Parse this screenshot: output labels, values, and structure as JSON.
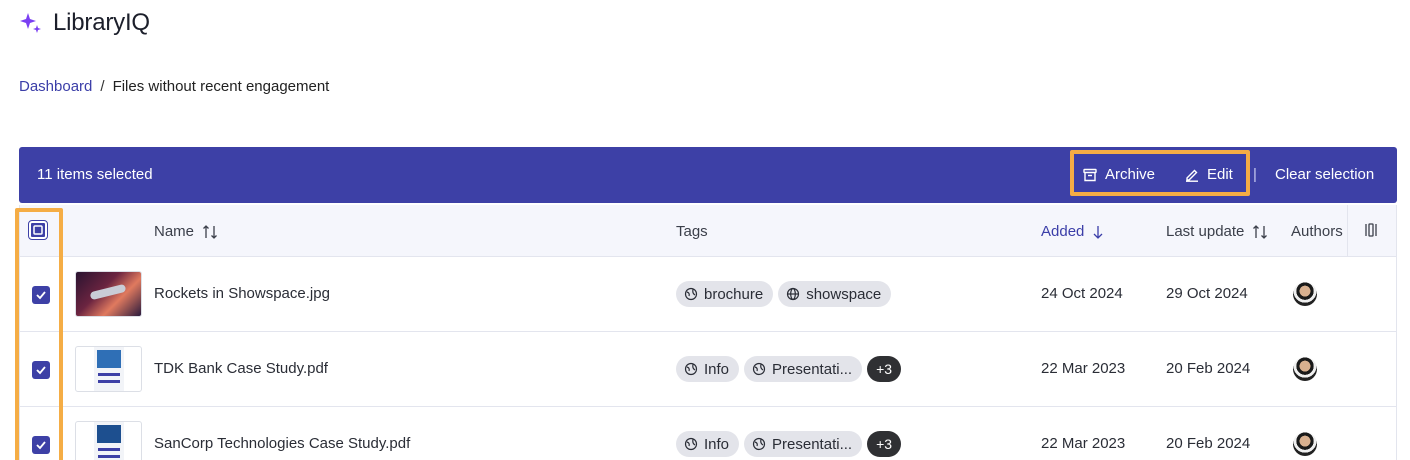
{
  "app": {
    "title": "LibraryIQ",
    "accent": "#3d40a6",
    "highlight": "#f5ad45"
  },
  "breadcrumb": {
    "parent": "Dashboard",
    "separator": "/",
    "current": "Files without recent engagement"
  },
  "selection_bar": {
    "count_text": "11 items selected",
    "archive_label": "Archive",
    "edit_label": "Edit",
    "divider": "|",
    "clear_label": "Clear selection"
  },
  "table": {
    "columns": {
      "name": "Name",
      "tags": "Tags",
      "added": "Added",
      "last_update": "Last update",
      "authors": "Authors"
    },
    "rows": [
      {
        "name": "Rockets in Showspace.jpg",
        "thumbnail": "image",
        "tags": [
          {
            "label": "brochure",
            "icon": "sync-globe-icon"
          },
          {
            "label": "showspace",
            "icon": "globe-icon"
          }
        ],
        "more": "",
        "added": "24 Oct 2024",
        "last_update": "29 Oct 2024"
      },
      {
        "name": "TDK Bank Case Study.pdf",
        "thumbnail": "pdf",
        "tags": [
          {
            "label": "Info",
            "icon": "sync-globe-icon"
          },
          {
            "label": "Presentati...",
            "icon": "sync-globe-icon"
          }
        ],
        "more": "+3",
        "added": "22 Mar 2023",
        "last_update": "20 Feb 2024"
      },
      {
        "name": "SanCorp Technologies Case Study.pdf",
        "thumbnail": "pdf",
        "tags": [
          {
            "label": "Info",
            "icon": "sync-globe-icon"
          },
          {
            "label": "Presentati...",
            "icon": "sync-globe-icon"
          }
        ],
        "more": "+3",
        "added": "22 Mar 2023",
        "last_update": "20 Feb 2024"
      }
    ]
  }
}
